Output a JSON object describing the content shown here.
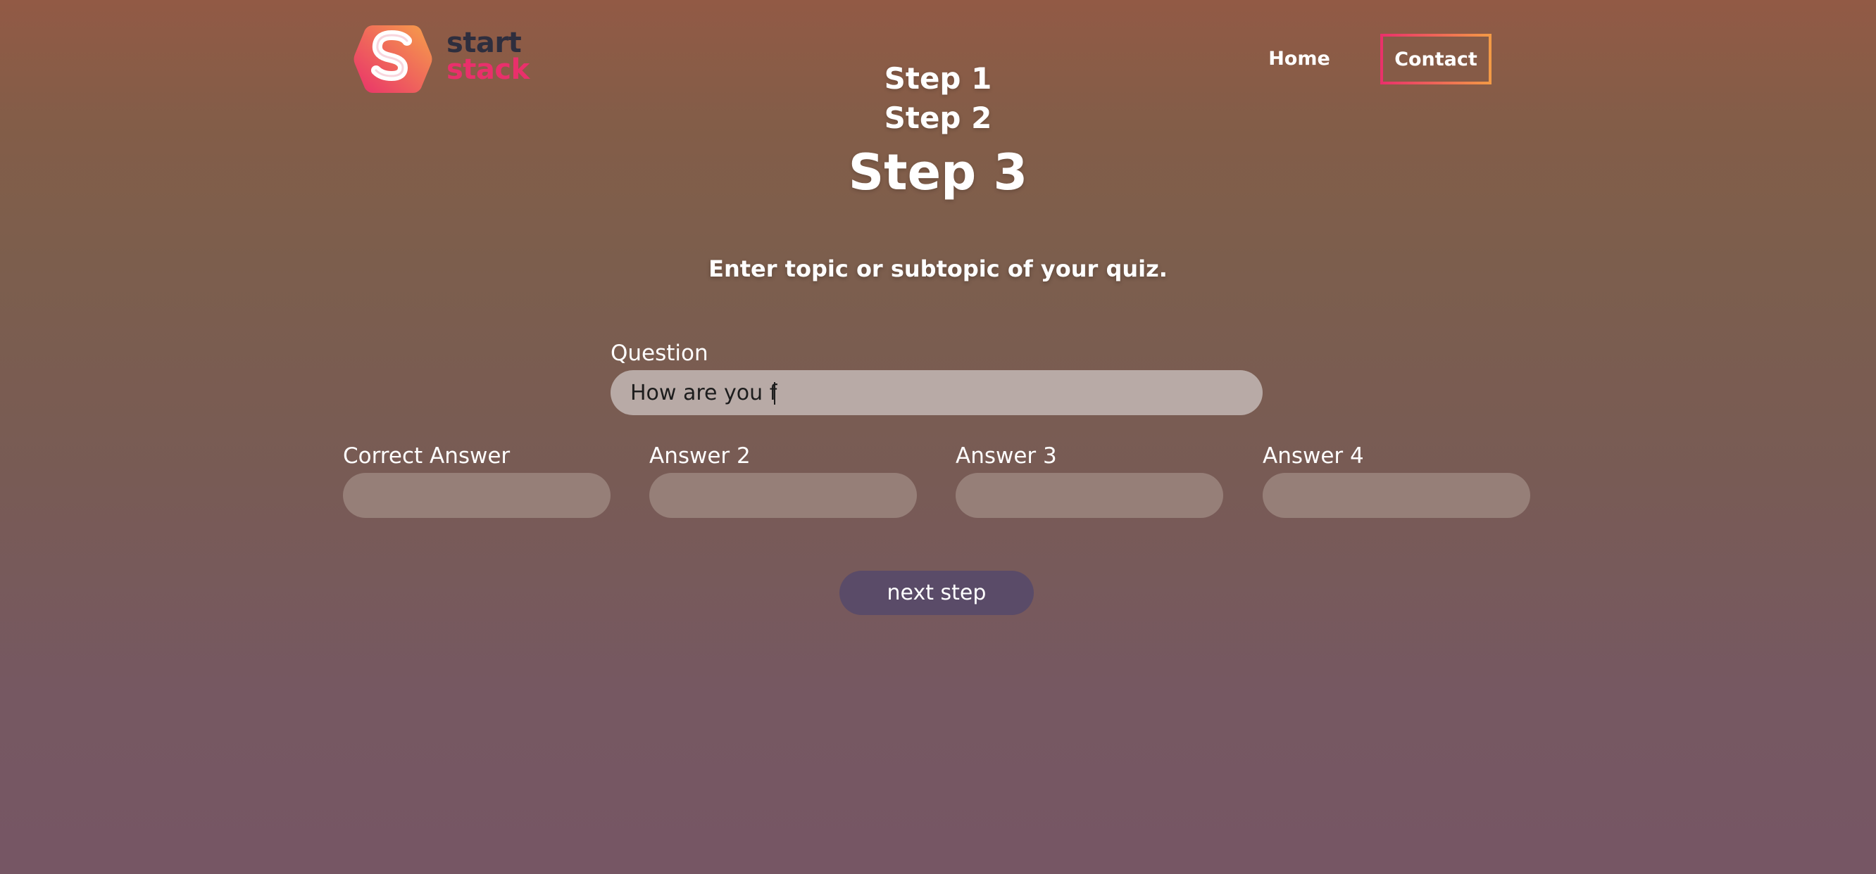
{
  "logo": {
    "line1": "start",
    "line2": "stack"
  },
  "nav": {
    "home": "Home",
    "contact": "Contact"
  },
  "steps": {
    "step1": "Step 1",
    "step2": "Step 2",
    "step3": "Step 3"
  },
  "subtitle": "Enter topic or subtopic of your quiz.",
  "form": {
    "question": {
      "label": "Question",
      "value": "How are you f"
    },
    "answers": [
      {
        "label": "Correct Answer",
        "value": ""
      },
      {
        "label": "Answer 2",
        "value": ""
      },
      {
        "label": "Answer 3",
        "value": ""
      },
      {
        "label": "Answer 4",
        "value": ""
      }
    ]
  },
  "next_button": "next step",
  "colors": {
    "brand_pink": "#e9306b",
    "brand_orange": "#f39b45",
    "brand_dark": "#2e2e3e",
    "button": "#5a4b68"
  },
  "icons": {
    "logo": "startstack-logo-icon"
  }
}
